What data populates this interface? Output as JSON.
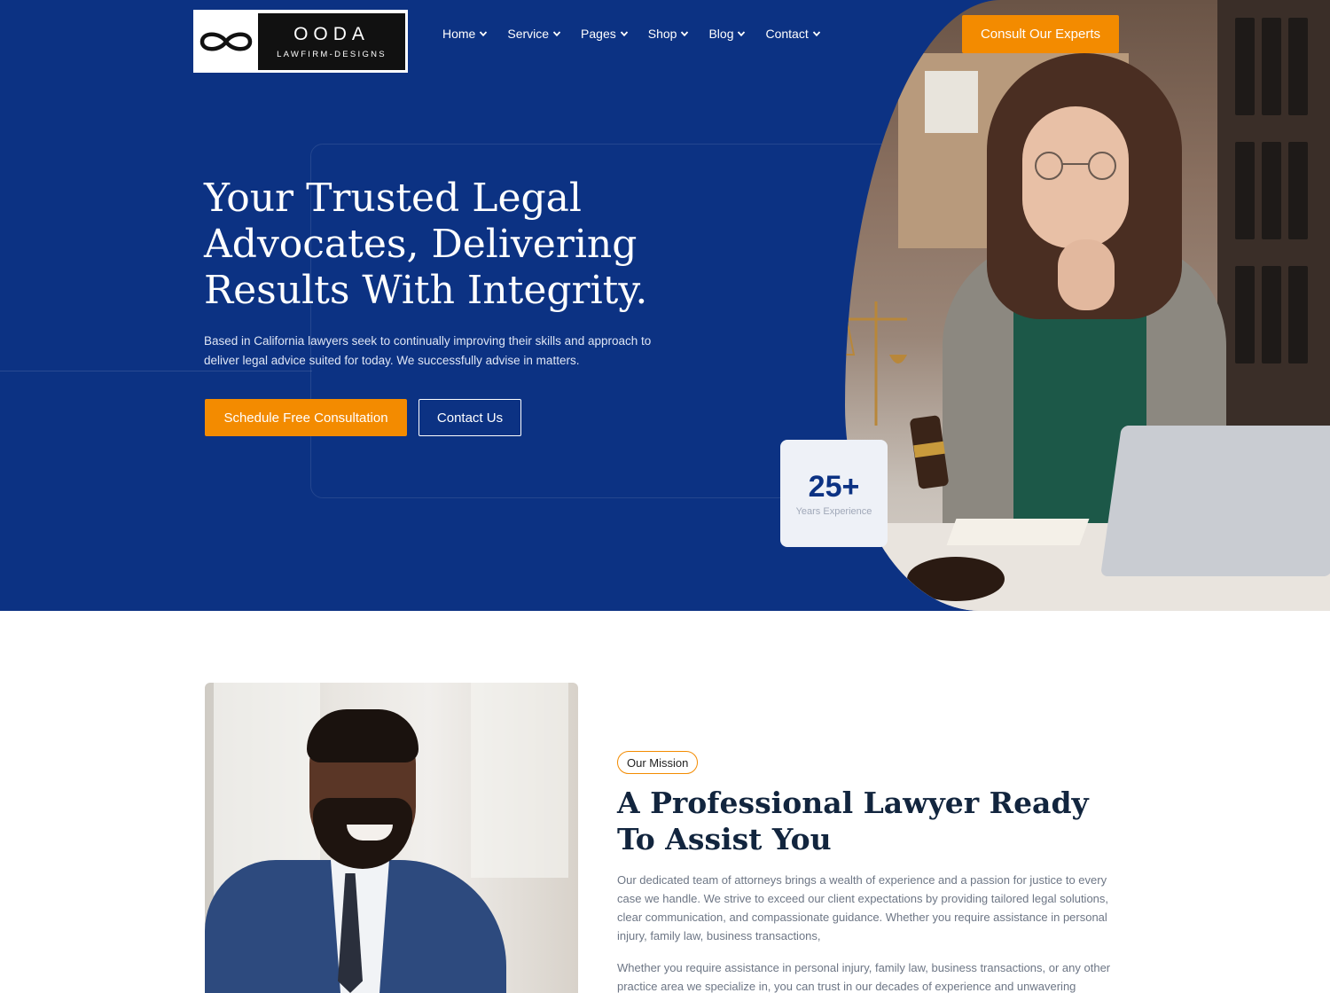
{
  "brand": {
    "name": "OODA",
    "tagline": "LAWFIRM-DESIGNS"
  },
  "nav": {
    "items": [
      {
        "label": "Home"
      },
      {
        "label": "Service"
      },
      {
        "label": "Pages"
      },
      {
        "label": "Shop"
      },
      {
        "label": "Blog"
      },
      {
        "label": "Contact"
      }
    ],
    "cta_label": "Consult Our Experts"
  },
  "hero": {
    "title": "Your Trusted Legal Advocates, Delivering Results With Integrity.",
    "text": "Based in California lawyers seek to continually improving their skills and approach to deliver legal advice suited for today. We successfully advise in matters.",
    "primary_button": "Schedule Free Consultation",
    "secondary_button": "Contact Us"
  },
  "stats": {
    "value": "25+",
    "label": "Years Experience"
  },
  "mission": {
    "badge": "Our Mission",
    "title": "A Professional Lawyer Ready To Assist You",
    "paragraph1": "Our dedicated team of attorneys brings a wealth of experience and a passion for justice to every case we handle. We strive to exceed our client expectations by providing tailored legal solutions, clear communication, and compassionate guidance. Whether you require assistance in personal injury, family law, business transactions,",
    "paragraph2": "Whether you require assistance in personal injury, family law, business transactions, or any other practice area we specialize in, you can trust in our decades of experience and unwavering"
  },
  "colors": {
    "primary": "#0c3283",
    "accent": "#f38b00",
    "heading": "#12253e",
    "body_text": "#6d7685"
  },
  "icons": {
    "logo": "infinity-icon",
    "nav_dropdown": "chevron-down-icon"
  }
}
